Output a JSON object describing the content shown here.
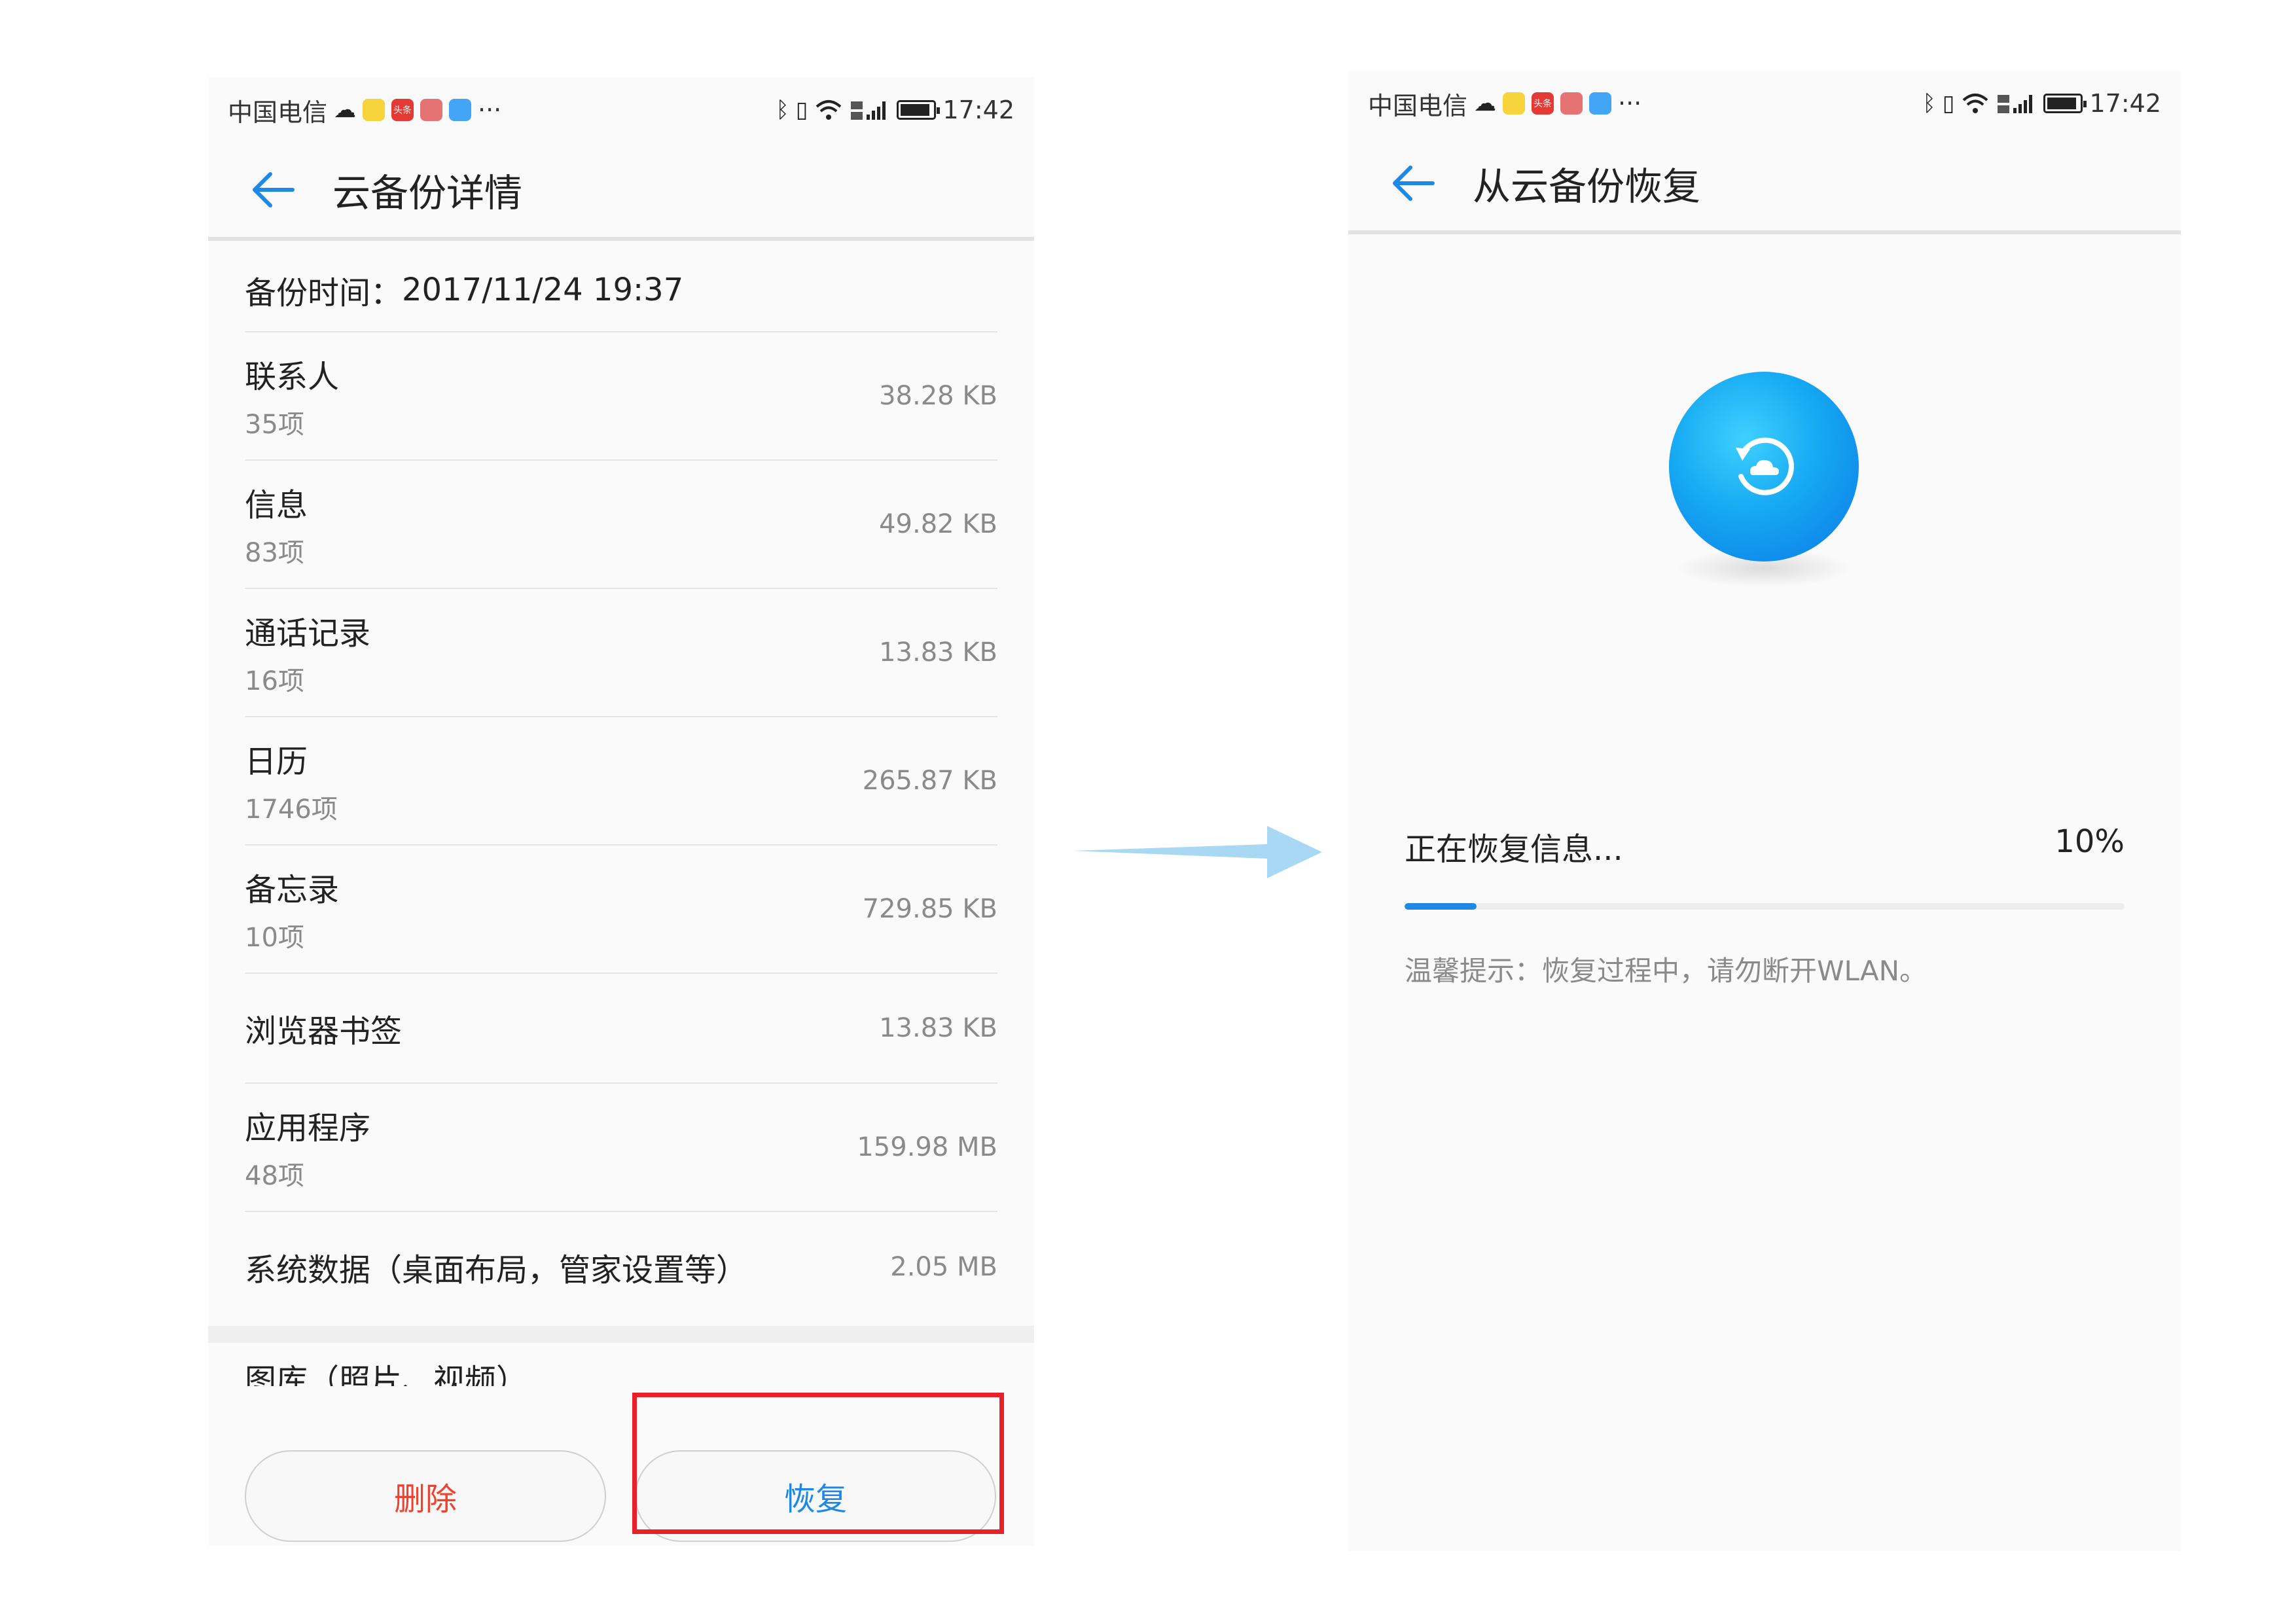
{
  "status_bar": {
    "carrier": "中国电信",
    "time": "17:42",
    "more": "···",
    "signal_text": "4G\n2G",
    "icons": [
      "cloud-icon",
      "music-app-icon",
      "toutiao-app-icon",
      "red-app-icon",
      "blue-app-icon",
      "bluetooth-icon",
      "vibrate-icon",
      "wifi-icon",
      "signal-icon",
      "battery-icon"
    ],
    "toutiao_label": "头条"
  },
  "left_screen": {
    "title": "云备份详情",
    "backup_time_label": "备份时间：",
    "backup_time_value": "2017/11/24 19:37",
    "items": [
      {
        "name": "联系人",
        "count": "35项",
        "size": "38.28 KB"
      },
      {
        "name": "信息",
        "count": "83项",
        "size": "49.82 KB"
      },
      {
        "name": "通话记录",
        "count": "16项",
        "size": "13.83 KB"
      },
      {
        "name": "日历",
        "count": "1746项",
        "size": "265.87 KB"
      },
      {
        "name": "备忘录",
        "count": "10项",
        "size": "729.85 KB"
      },
      {
        "name": "浏览器书签",
        "count": "",
        "size": "13.83 KB"
      },
      {
        "name": "应用程序",
        "count": "48项",
        "size": "159.98 MB"
      },
      {
        "name": "系统数据（桌面布局，管家设置等）",
        "count": "",
        "size": "2.05 MB"
      }
    ],
    "gallery_peek": "图库（照片、视频）",
    "delete_label": "删除",
    "restore_label": "恢复",
    "colors": {
      "delete": "#f0402e",
      "restore": "#1e88e5",
      "highlight": "#e8202a"
    }
  },
  "right_screen": {
    "title": "从云备份恢复",
    "progress_label": "正在恢复信息...",
    "progress_percent": "10%",
    "progress_value": 0.1,
    "tip": "温馨提示：恢复过程中，请勿断开WLAN。",
    "colors": {
      "accent": "#1e88e5",
      "orb": "#16a8f2"
    }
  }
}
